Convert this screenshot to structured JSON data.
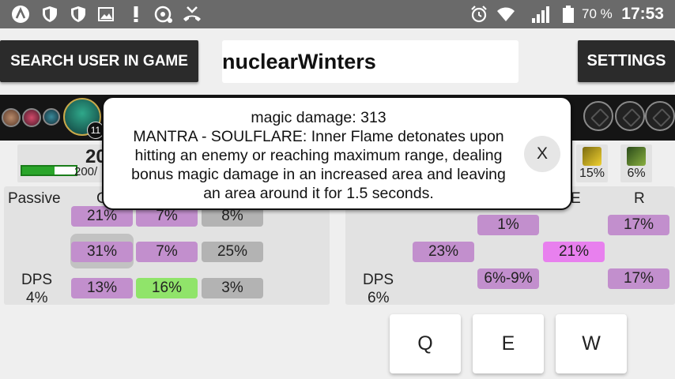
{
  "status_bar": {
    "battery_text": "70 %",
    "time": "17:53",
    "icons": [
      "app-a-icon",
      "shield-check-icon",
      "shield-icon",
      "image-icon",
      "alert-icon",
      "call-logo-icon",
      "missed-call-icon",
      "alarm-icon",
      "wifi-icon",
      "signal-icon",
      "battery-icon"
    ]
  },
  "header": {
    "search_user_label": "SEARCH USER IN GAME",
    "username_value": "nuclearWinters",
    "settings_label": "SETTINGS"
  },
  "champion": {
    "level_badge": "11",
    "stat_top": "20",
    "stat_sub": "200/",
    "hp_fraction": 0.6
  },
  "items": [
    {
      "icon": "lightning-item-icon",
      "value": "15%"
    },
    {
      "icon": "blade-item-icon",
      "value": "6%"
    }
  ],
  "left_panel": {
    "passive_label": "Passive",
    "q_partial_label": "C",
    "dps_label": "DPS",
    "dps_value": "4%",
    "rows": [
      [
        "21%",
        "7%",
        "8%"
      ],
      [
        "31%",
        "7%",
        "25%"
      ],
      [
        "13%",
        "16%",
        "3%"
      ]
    ]
  },
  "right_panel": {
    "e_partial_label": "E",
    "r_label": "R",
    "dps_label": "DPS",
    "dps_value": "6%",
    "row1": [
      "1%",
      "17%"
    ],
    "row2": [
      "23%",
      "21%"
    ],
    "row3": [
      "6%-9%",
      "17%"
    ]
  },
  "keys": {
    "q": "Q",
    "e": "E",
    "w": "W"
  },
  "tooltip": {
    "line1": "magic damage: 313",
    "line2": "MANTRA - SOULFLARE: Inner Flame detonates upon",
    "line3": "hitting an enemy or reaching maximum range, dealing",
    "line4": "bonus magic damage in an increased area and leaving",
    "line5": "an area around it for 1.5 seconds.",
    "close_label": "X"
  }
}
